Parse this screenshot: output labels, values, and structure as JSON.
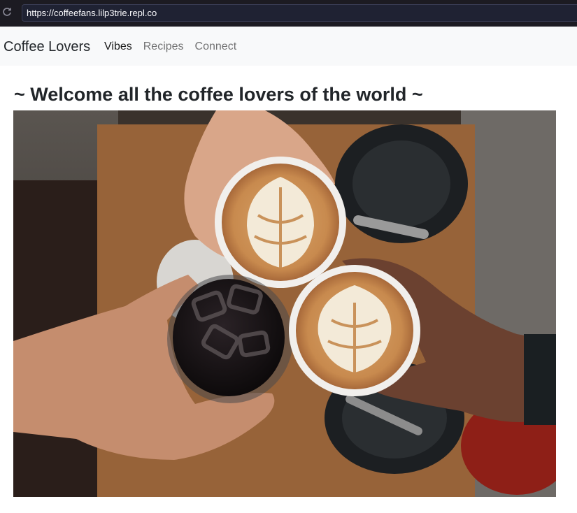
{
  "browser": {
    "url": "https://coffeefans.lilp3trie.repl.co"
  },
  "navbar": {
    "brand": "Coffee Lovers",
    "links": [
      {
        "label": "Vibes",
        "active": true
      },
      {
        "label": "Recipes",
        "active": false
      },
      {
        "label": "Connect",
        "active": false
      }
    ]
  },
  "main": {
    "headline": "~ Welcome all the coffee lovers of the world ~",
    "hero_image": {
      "subject": "three hands toasting two latte-art cups and a glass of iced coffee over a wooden table"
    }
  },
  "colors": {
    "navbar_bg": "#f8f9fa",
    "chrome_bg": "#1c1b22",
    "text": "#212529"
  }
}
